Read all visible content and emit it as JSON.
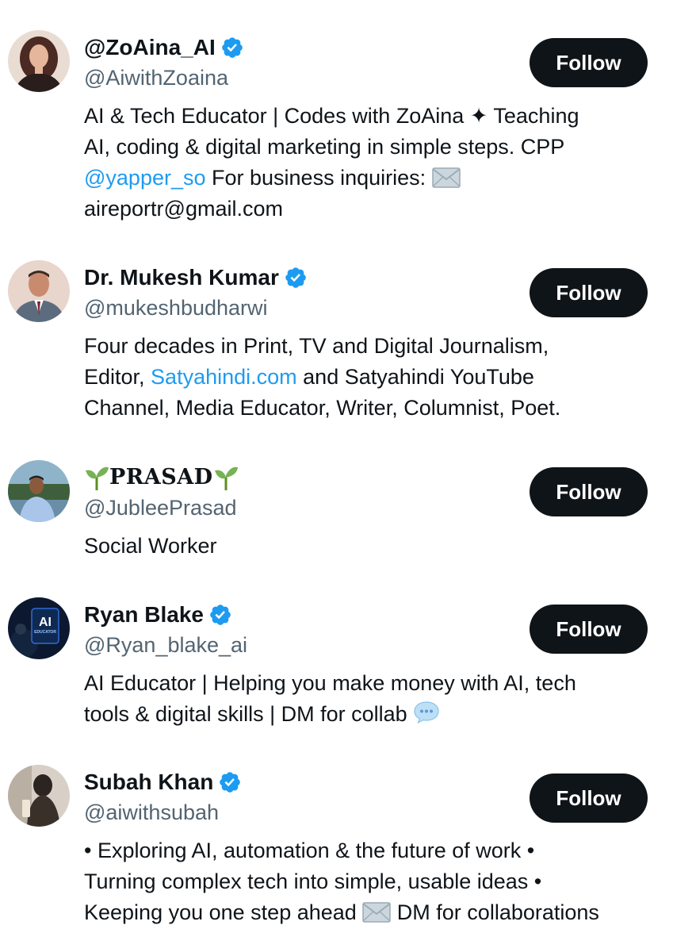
{
  "users": [
    {
      "name": "@ZoAina_AI",
      "verified": true,
      "handle": "@AiwithZoaina",
      "bio_lines": [
        [
          "AI & Tech Educator | Codes with ZoAina ✦ Teaching"
        ],
        [
          "AI, coding & digital marketing in simple steps. CPP"
        ],
        [
          "@yapper_so",
          " For business inquiries: "
        ],
        [
          "aireportr@gmail.com"
        ]
      ],
      "follow_label": "Follow"
    },
    {
      "name": "Dr. Mukesh Kumar",
      "verified": true,
      "handle": "@mukeshbudharwi",
      "bio_lines": [
        [
          "Four decades in Print, TV and Digital Journalism,"
        ],
        [
          "Editor, ",
          "Satyahindi.com",
          " and Satyahindi YouTube"
        ],
        [
          "Channel, Media Educator, Writer, Columnist, Poet."
        ]
      ],
      "follow_label": "Follow"
    },
    {
      "name": "PRASAD",
      "verified": false,
      "handle": "@JubleePrasad",
      "bio_lines": [
        [
          "Social Worker"
        ]
      ],
      "follow_label": "Follow"
    },
    {
      "name": "Ryan Blake",
      "verified": true,
      "handle": "@Ryan_blake_ai",
      "bio_lines": [
        [
          "AI Educator | Helping you make money with AI, tech"
        ],
        [
          "tools & digital skills | DM for collab "
        ]
      ],
      "avatar_text": "AI",
      "avatar_subtext": "EDUCATOR",
      "follow_label": "Follow"
    },
    {
      "name": "Subah Khan",
      "verified": true,
      "handle": "@aiwithsubah",
      "bio_lines": [
        [
          "• Exploring AI, automation & the future of work •"
        ],
        [
          "Turning complex tech into simple, usable ideas •"
        ],
        [
          "Keeping you one step ahead ",
          " DM for collaborations"
        ]
      ],
      "follow_label": "Follow"
    }
  ],
  "icons": {
    "verified": "verified-badge-icon",
    "envelope": "envelope-emoji-icon",
    "speech": "speech-balloon-emoji-icon",
    "sprout": "seedling-emoji-icon"
  },
  "colors": {
    "link": "#1d9bf0",
    "verified": "#1d9bf0",
    "button_bg": "#0f1419",
    "handle": "#536471"
  }
}
